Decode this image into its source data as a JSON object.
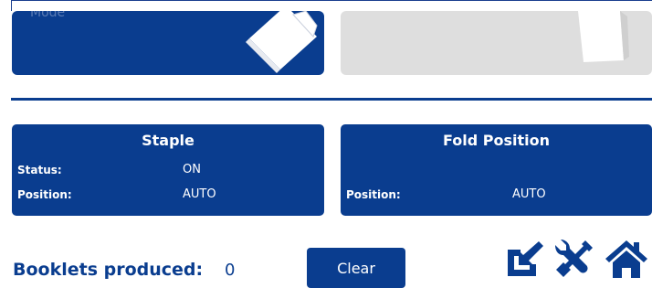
{
  "top": {
    "cut_label": "Mode"
  },
  "staple": {
    "title": "Staple",
    "status_label": "Status:",
    "status_value": "ON",
    "position_label": "Position:",
    "position_value": "AUTO"
  },
  "fold": {
    "title": "Fold Position",
    "position_label": "Position:",
    "position_value": "AUTO"
  },
  "footer": {
    "booklets_label": "Booklets produced:",
    "booklets_count": "0",
    "clear_label": "Clear"
  },
  "icons": {
    "export": "export-icon",
    "tools": "tools-icon",
    "home": "home-icon"
  },
  "colors": {
    "primary": "#0a3d8f",
    "tile_gray": "#dedede",
    "white": "#ffffff"
  }
}
